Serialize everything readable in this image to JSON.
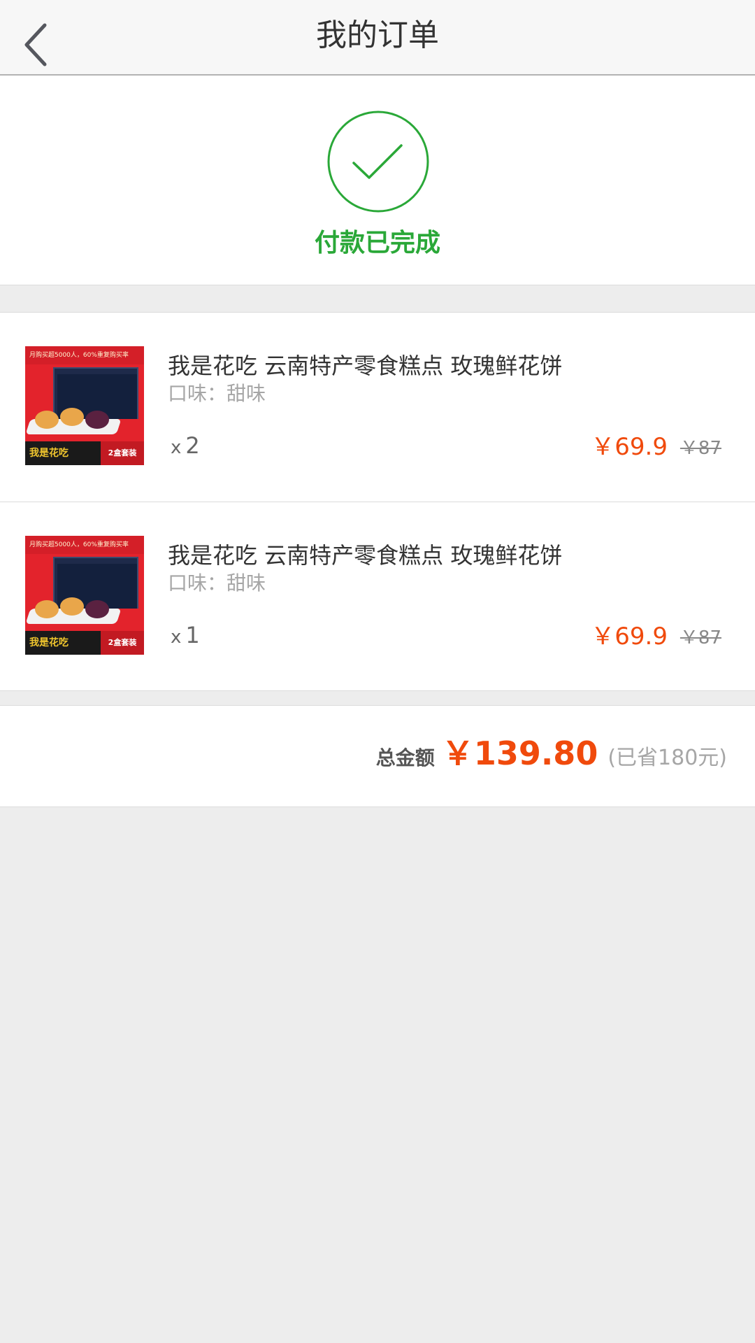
{
  "header": {
    "title": "我的订单"
  },
  "status": {
    "text": "付款已完成",
    "color": "#2aa838"
  },
  "items": [
    {
      "name": "我是花吃 云南特产零食糕点 玫瑰鲜花饼",
      "flavor": "口味：甜味",
      "qty_prefix": "x",
      "qty": "2",
      "price": "￥69.9",
      "original_price": "￥87",
      "thumb": {
        "banner": "月购买超5000人，60%重复购买率",
        "brand": "我是花吃",
        "badge": "2盒套装"
      }
    },
    {
      "name": "我是花吃 云南特产零食糕点 玫瑰鲜花饼",
      "flavor": "口味：甜味",
      "qty_prefix": "x",
      "qty": "1",
      "price": "￥69.9",
      "original_price": "￥87",
      "thumb": {
        "banner": "月购买超5000人，60%重复购买率",
        "brand": "我是花吃",
        "badge": "2盒套装"
      }
    }
  ],
  "total": {
    "label": "总金额",
    "amount": "￥139.80",
    "saved": "(已省180元)"
  },
  "colors": {
    "accent_price": "#f04a0c",
    "success": "#2aa838"
  },
  "icons": {
    "back": "chevron-left-icon",
    "status": "check-circle-icon"
  }
}
